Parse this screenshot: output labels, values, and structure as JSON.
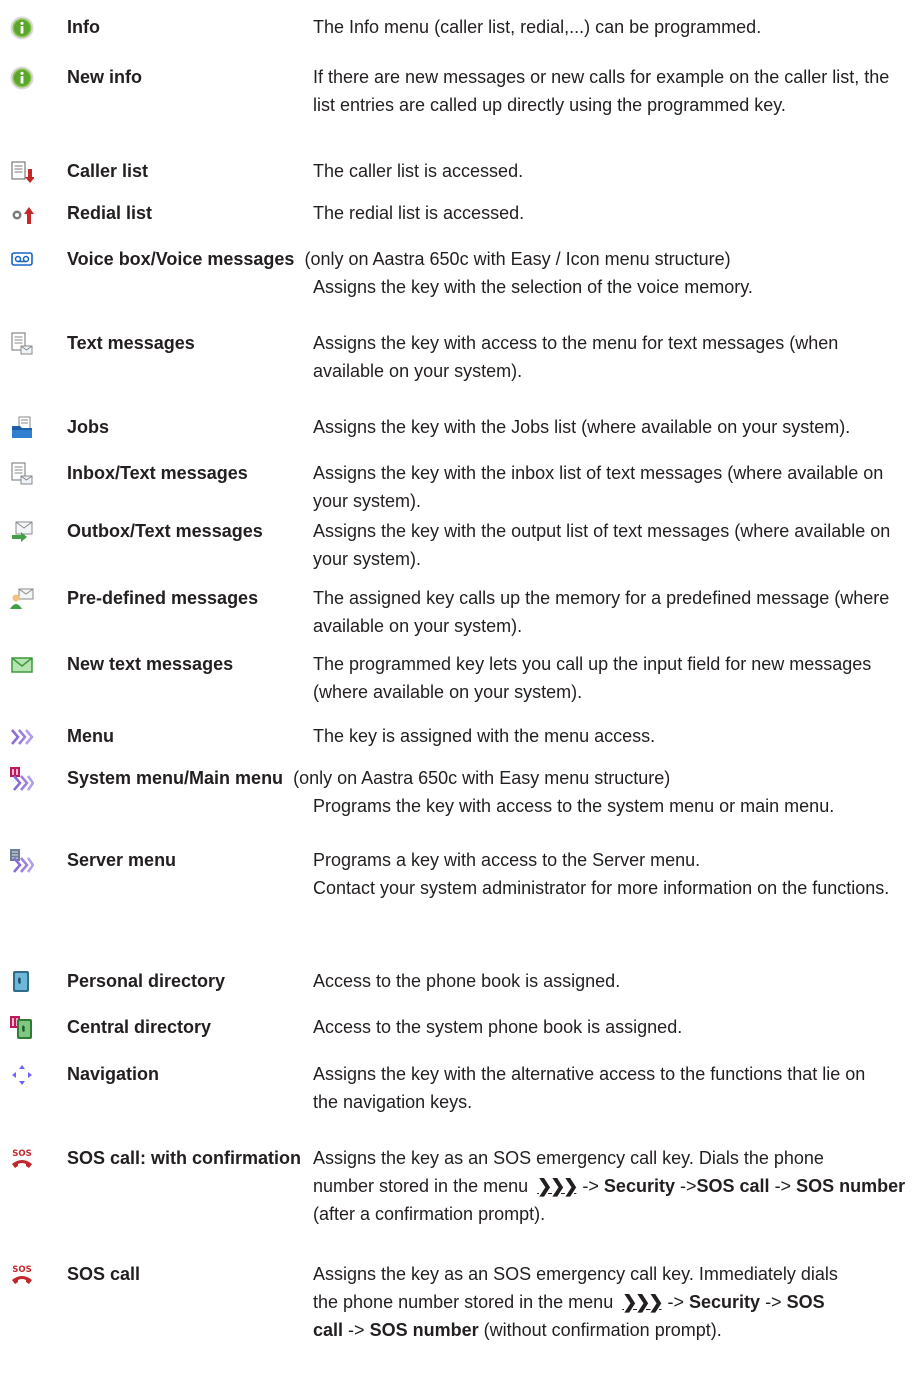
{
  "entries": [
    {
      "icon": "info-icon",
      "term": "Info",
      "desc": "The Info menu (caller list, redial,...) can be programmed."
    },
    {
      "icon": "info-icon",
      "term": "New info",
      "desc": "If there are new messages or new calls for example on the caller list, the list entries are called up directly using the programmed key."
    },
    {
      "icon": "caller-list-icon",
      "term": "Caller list",
      "desc": "The caller list is accessed."
    },
    {
      "icon": "redial-list-icon",
      "term": "Redial list",
      "desc": "The redial list is accessed."
    },
    {
      "icon": "voicebox-icon",
      "term": "Voice box/Voice messages",
      "note": "(only on Aastra 650c with Easy / Icon menu structure)",
      "desc": "Assigns the key with the selection of the voice memory."
    },
    {
      "icon": "text-messages-icon",
      "term": "Text messages",
      "desc": "Assigns the key with access to the menu for text messages (when available on your system)."
    },
    {
      "icon": "jobs-icon",
      "term": "Jobs",
      "desc": "Assigns the key with the Jobs list (where available on your system)."
    },
    {
      "icon": "inbox-icon",
      "term": "Inbox/Text messages",
      "desc": "Assigns the key with the inbox list of text messages (where available on your system)."
    },
    {
      "icon": "outbox-icon",
      "term": "Outbox/Text messages",
      "desc": "Assigns the key with the output list of text messages (where available on your system)."
    },
    {
      "icon": "predefined-messages-icon",
      "term": "Pre-defined messages",
      "desc": "The assigned key calls up the memory for a predefined message (where available on your system)."
    },
    {
      "icon": "new-text-message-icon",
      "term": "New text messages",
      "desc": "The programmed key lets you call up the input field for new messages (where available on your system)."
    },
    {
      "icon": "menu-icon",
      "term": "Menu",
      "desc": "The key is assigned with the menu access."
    },
    {
      "icon": "system-menu-icon",
      "term": "System menu/Main menu",
      "note": "(only on Aastra 650c with Easy menu structure)",
      "desc": "Programs the key with access to the system menu or main menu."
    },
    {
      "icon": "server-menu-icon",
      "term": "Server menu",
      "desc": "Programs a key with access to the Server menu.",
      "desc2": "Contact your system administrator for more information on the functions."
    },
    {
      "icon": "personal-directory-icon",
      "term": "Personal directory",
      "desc": "Access to the phone book is assigned."
    },
    {
      "icon": "central-directory-icon",
      "term": "Central directory",
      "desc": "Access to the system phone book is assigned."
    },
    {
      "icon": "navigation-icon",
      "term": "Navigation",
      "desc": "Assigns the key with the alternative access to the functions that lie on the navigation keys."
    },
    {
      "icon": "sos-call-icon",
      "term": "SOS call: with confirmation",
      "desc_a": "Assigns the key as an SOS emergency call key. Dials the phone",
      "desc_b": "number stored in the menu",
      "path": [
        "Security",
        "SOS call",
        "SOS number"
      ],
      "tail": "(after a confirmation prompt)."
    },
    {
      "icon": "sos-call-icon",
      "term": "SOS call",
      "desc_a": "Assigns the key as an SOS emergency call key. Immediately dials",
      "desc_b": "the phone number stored in the menu",
      "path": [
        "Security",
        "SOS call",
        "SOS number"
      ],
      "tail": "(without confirmation prompt)."
    }
  ],
  "menu_glyph": "❯❯❯",
  "arrow": "->",
  "colors": {
    "text": "#231f20",
    "info_green": "#55a630",
    "red": "#c62828",
    "blue": "#1565c0",
    "msg_green": "#43a047",
    "menu_purple": "#8a6ad8",
    "sos_red": "#c0282d"
  }
}
